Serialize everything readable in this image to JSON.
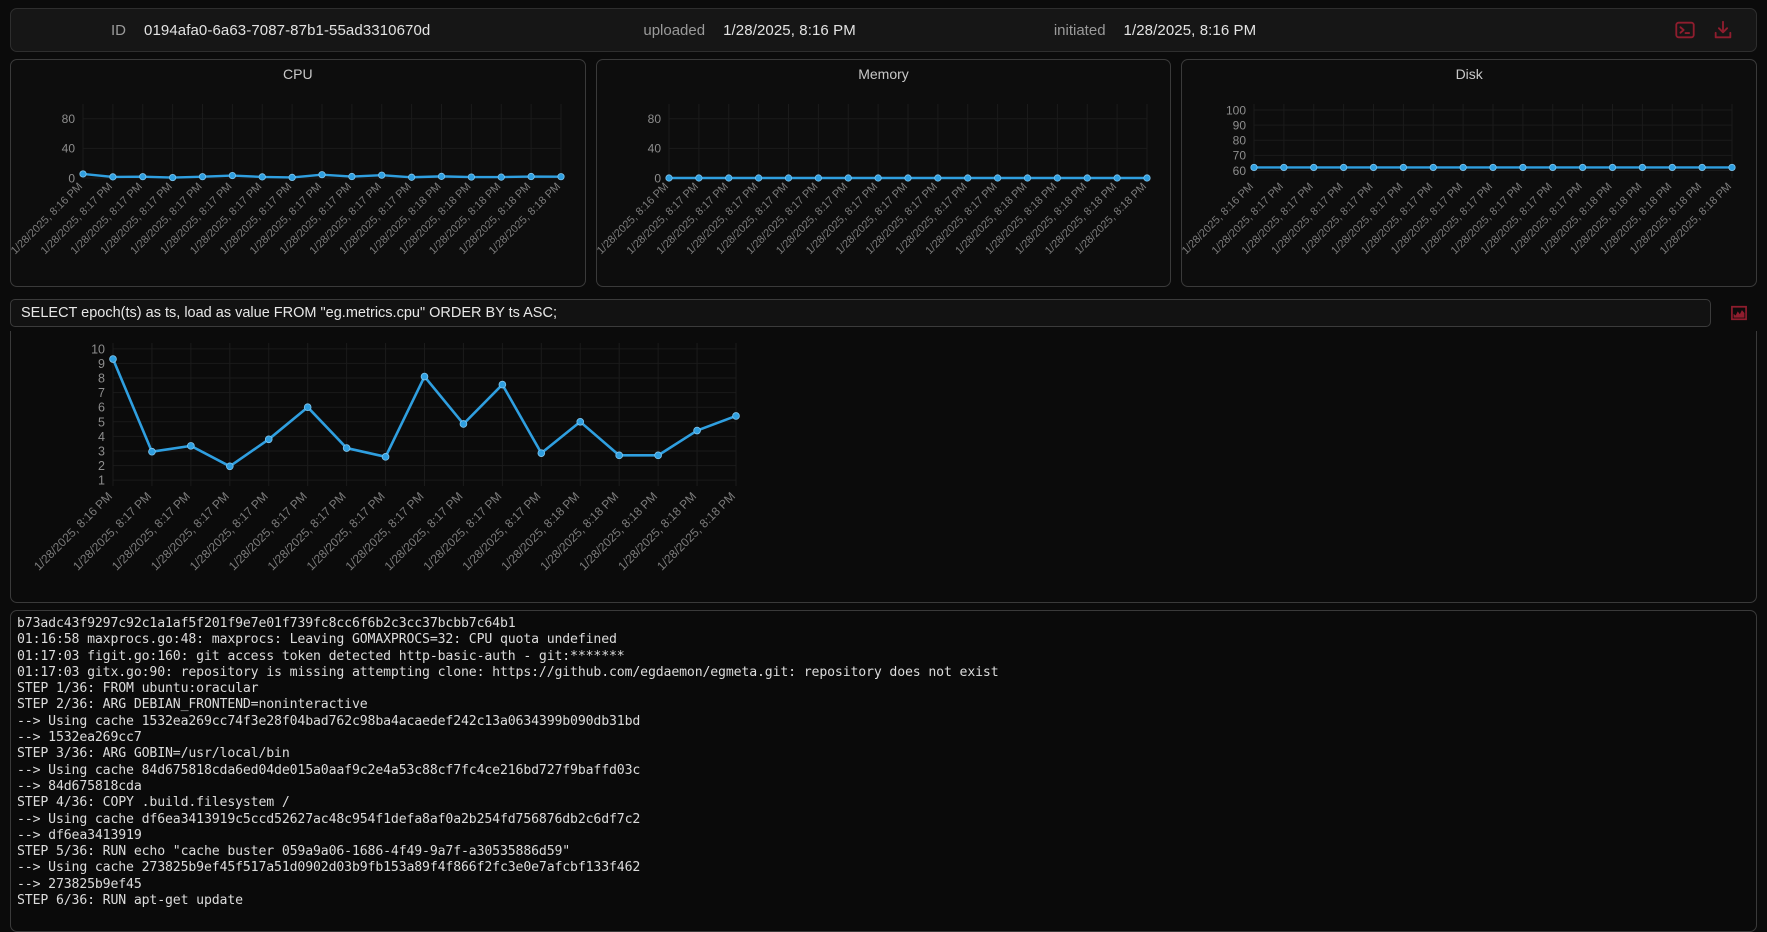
{
  "header": {
    "id_label": "ID",
    "id_value": "0194afa0-6a63-7087-87b1-55ad3310670d",
    "uploaded_label": "uploaded",
    "uploaded_value": "1/28/2025, 8:16 PM",
    "initiated_label": "initiated",
    "initiated_value": "1/28/2025, 8:16 PM",
    "terminal_icon": "terminal-icon",
    "download_icon": "download-icon",
    "accent_red": "#8f1d2e"
  },
  "query": {
    "value": "SELECT epoch(ts) as ts, load as value FROM \"eg.metrics.cpu\" ORDER BY ts ASC;",
    "placeholder": "SELECT ...",
    "chart_icon": "bar-chart-icon"
  },
  "chart_data": [
    {
      "id": "cpu",
      "type": "line",
      "title": "CPU",
      "xlabel": "",
      "ylabel": "",
      "ylim": [
        0,
        100
      ],
      "yticks": [
        0,
        40,
        80
      ],
      "grid": true,
      "legend": false,
      "line_color": "#2f9fe0",
      "categories": [
        "1/28/2025, 8:16 PM",
        "1/28/2025, 8:17 PM",
        "1/28/2025, 8:17 PM",
        "1/28/2025, 8:17 PM",
        "1/28/2025, 8:17 PM",
        "1/28/2025, 8:17 PM",
        "1/28/2025, 8:17 PM",
        "1/28/2025, 8:17 PM",
        "1/28/2025, 8:17 PM",
        "1/28/2025, 8:17 PM",
        "1/28/2025, 8:17 PM",
        "1/28/2025, 8:17 PM",
        "1/28/2025, 8:18 PM",
        "1/28/2025, 8:18 PM",
        "1/28/2025, 8:18 PM",
        "1/28/2025, 8:18 PM",
        "1/28/2025, 8:18 PM"
      ],
      "values": [
        5.5,
        1.5,
        1.8,
        0.6,
        1.8,
        3.3,
        1.5,
        0.8,
        4.5,
        2.0,
        3.8,
        1.0,
        2.2,
        1.3,
        1.2,
        2.0,
        1.8
      ]
    },
    {
      "id": "memory",
      "type": "line",
      "title": "Memory",
      "xlabel": "",
      "ylabel": "",
      "ylim": [
        0,
        100
      ],
      "yticks": [
        0,
        40,
        80
      ],
      "grid": true,
      "legend": false,
      "line_color": "#2f9fe0",
      "categories": [
        "1/28/2025, 8:16 PM",
        "1/28/2025, 8:17 PM",
        "1/28/2025, 8:17 PM",
        "1/28/2025, 8:17 PM",
        "1/28/2025, 8:17 PM",
        "1/28/2025, 8:17 PM",
        "1/28/2025, 8:17 PM",
        "1/28/2025, 8:17 PM",
        "1/28/2025, 8:17 PM",
        "1/28/2025, 8:17 PM",
        "1/28/2025, 8:17 PM",
        "1/28/2025, 8:17 PM",
        "1/28/2025, 8:18 PM",
        "1/28/2025, 8:18 PM",
        "1/28/2025, 8:18 PM",
        "1/28/2025, 8:18 PM",
        "1/28/2025, 8:18 PM"
      ],
      "values": [
        0,
        0,
        0,
        0,
        0,
        0,
        0,
        0,
        0,
        0,
        0,
        0,
        0,
        0,
        0,
        0,
        0
      ]
    },
    {
      "id": "disk",
      "type": "line",
      "title": "Disk",
      "xlabel": "",
      "ylabel": "",
      "ylim": [
        55,
        104
      ],
      "yticks": [
        60,
        70,
        80,
        90,
        100
      ],
      "grid": true,
      "legend": false,
      "line_color": "#2f9fe0",
      "categories": [
        "1/28/2025, 8:16 PM",
        "1/28/2025, 8:17 PM",
        "1/28/2025, 8:17 PM",
        "1/28/2025, 8:17 PM",
        "1/28/2025, 8:17 PM",
        "1/28/2025, 8:17 PM",
        "1/28/2025, 8:17 PM",
        "1/28/2025, 8:17 PM",
        "1/28/2025, 8:17 PM",
        "1/28/2025, 8:17 PM",
        "1/28/2025, 8:17 PM",
        "1/28/2025, 8:17 PM",
        "1/28/2025, 8:18 PM",
        "1/28/2025, 8:18 PM",
        "1/28/2025, 8:18 PM",
        "1/28/2025, 8:18 PM",
        "1/28/2025, 8:18 PM"
      ],
      "values": [
        62,
        62,
        62,
        62,
        62,
        62,
        62,
        62,
        62,
        62,
        62,
        62,
        62,
        62,
        62,
        62,
        62
      ]
    },
    {
      "id": "query-result",
      "type": "line",
      "title": "",
      "xlabel": "",
      "ylabel": "",
      "ylim": [
        0.6,
        10.4
      ],
      "yticks": [
        1,
        2,
        3,
        4,
        5,
        6,
        7,
        8,
        9,
        10
      ],
      "grid": true,
      "legend": false,
      "line_color": "#2f9fe0",
      "categories": [
        "1/28/2025, 8:16 PM",
        "1/28/2025, 8:17 PM",
        "1/28/2025, 8:17 PM",
        "1/28/2025, 8:17 PM",
        "1/28/2025, 8:17 PM",
        "1/28/2025, 8:17 PM",
        "1/28/2025, 8:17 PM",
        "1/28/2025, 8:17 PM",
        "1/28/2025, 8:17 PM",
        "1/28/2025, 8:17 PM",
        "1/28/2025, 8:17 PM",
        "1/28/2025, 8:17 PM",
        "1/28/2025, 8:18 PM",
        "1/28/2025, 8:18 PM",
        "1/28/2025, 8:18 PM",
        "1/28/2025, 8:18 PM",
        "1/28/2025, 8:18 PM"
      ],
      "values": [
        9.3,
        2.95,
        3.35,
        1.95,
        3.8,
        6.0,
        3.2,
        2.6,
        8.1,
        4.85,
        7.55,
        2.85,
        5.0,
        2.7,
        2.7,
        4.4,
        5.4
      ]
    }
  ],
  "log": {
    "lines": [
      "b73adc43f9297c92c1a1af5f201f9e7e01f739fc8cc6f6b2c3cc37bcbb7c64b1",
      "01:16:58 maxprocs.go:48: maxprocs: Leaving GOMAXPROCS=32: CPU quota undefined",
      "01:17:03 figit.go:160: git access token detected http-basic-auth - git:*******",
      "01:17:03 gitx.go:90: repository is missing attempting clone: https://github.com/egdaemon/egmeta.git: repository does not exist",
      "STEP 1/36: FROM ubuntu:oracular",
      "STEP 2/36: ARG DEBIAN_FRONTEND=noninteractive",
      "--> Using cache 1532ea269cc74f3e28f04bad762c98ba4acaedef242c13a0634399b090db31bd",
      "--> 1532ea269cc7",
      "STEP 3/36: ARG GOBIN=/usr/local/bin",
      "--> Using cache 84d675818cda6ed04de015a0aaf9c2e4a53c88cf7fc4ce216bd727f9baffd03c",
      "--> 84d675818cda",
      "STEP 4/36: COPY .build.filesystem /",
      "--> Using cache df6ea3413919c5ccd52627ac48c954f1defa8af0a2b254fd756876db2c6df7c2",
      "--> df6ea3413919",
      "STEP 5/36: RUN echo \"cache buster 059a9a06-1686-4f49-9a7f-a30535886d59\"",
      "--> Using cache 273825b9ef45f517a51d0902d03b9fb153a89f4f866f2fc3e0e7afcbf133f462",
      "--> 273825b9ef45",
      "STEP 6/36: RUN apt-get update"
    ]
  }
}
